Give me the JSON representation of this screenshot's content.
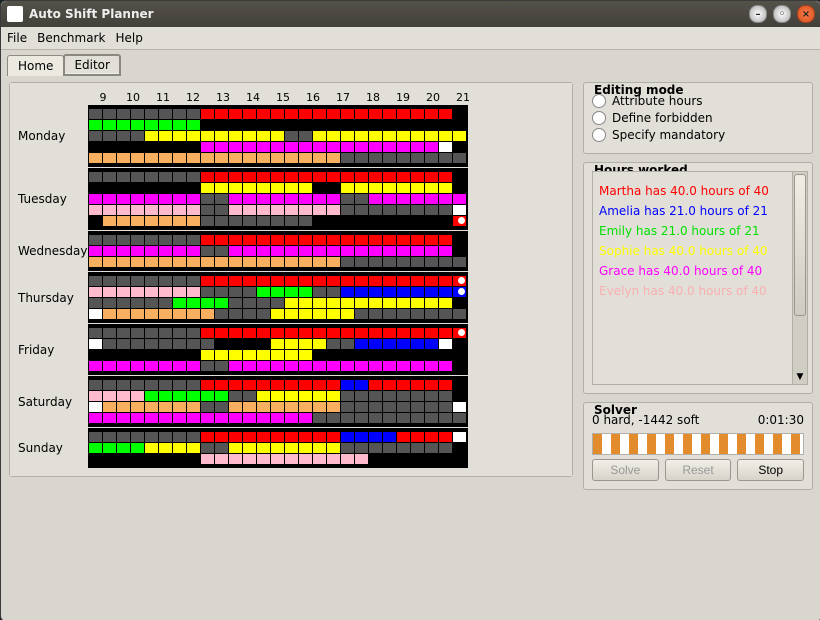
{
  "window_title": "Auto Shift Planner",
  "menu": [
    "File",
    "Benchmark",
    "Help"
  ],
  "tabs": [
    {
      "label": "Home",
      "active": false
    },
    {
      "label": "Editor",
      "active": true
    }
  ],
  "editor_title": "Editor",
  "hours": [
    "9",
    "10",
    "11",
    "12",
    "13",
    "14",
    "15",
    "16",
    "17",
    "18",
    "19",
    "20",
    "21"
  ],
  "cols": 27,
  "days": [
    "Monday",
    "Tuesday",
    "Wednesday",
    "Thursday",
    "Friday",
    "Saturday",
    "Sunday"
  ],
  "schedule": {
    "Monday": [
      [
        [
          "#555",
          8
        ],
        [
          "#f00",
          18
        ],
        [
          "#000",
          1
        ]
      ],
      [
        [
          "#0f0",
          8
        ],
        [
          "#000",
          19
        ]
      ],
      [
        [
          "#555",
          4
        ],
        [
          "#ff0",
          10
        ],
        [
          "#555",
          2
        ],
        [
          "#ff0",
          11
        ]
      ],
      [
        [
          "#000",
          8
        ],
        [
          "#f0f",
          17
        ],
        [
          "#fff",
          1,
          true
        ],
        [
          "#000",
          1
        ]
      ],
      [
        [
          "#f8b060",
          18
        ],
        [
          "#555",
          9
        ]
      ]
    ],
    "Tuesday": [
      [
        [
          "#555",
          8
        ],
        [
          "#f00",
          18
        ],
        [
          "#000",
          1
        ]
      ],
      [
        [
          "#000",
          8
        ],
        [
          "#ff0",
          8
        ],
        [
          "#000",
          2
        ],
        [
          "#ff0",
          8
        ],
        [
          "#000",
          1
        ]
      ],
      [
        [
          "#f0f",
          8
        ],
        [
          "#555",
          2
        ],
        [
          "#f0f",
          8
        ],
        [
          "#555",
          2
        ],
        [
          "#f0f",
          7
        ]
      ],
      [
        [
          "#fbc",
          8
        ],
        [
          "#555",
          2
        ],
        [
          "#fbc",
          8
        ],
        [
          "#555",
          8
        ],
        [
          "#fff",
          1,
          true
        ]
      ],
      [
        [
          "#000",
          1
        ],
        [
          "#f8b060",
          7
        ],
        [
          "#555",
          8
        ],
        [
          "#000",
          10
        ],
        [
          "#f00",
          1,
          true
        ]
      ]
    ],
    "Wednesday": [
      [
        [
          "#555",
          8
        ],
        [
          "#f00",
          18
        ],
        [
          "#000",
          1
        ]
      ],
      [
        [
          "#f0f",
          8
        ],
        [
          "#555",
          2
        ],
        [
          "#f0f",
          16
        ],
        [
          "#000",
          1
        ]
      ],
      [
        [
          "#f8b060",
          18
        ],
        [
          "#555",
          9
        ]
      ]
    ],
    "Thursday": [
      [
        [
          "#555",
          8
        ],
        [
          "#f00",
          18
        ],
        [
          "#f00",
          1,
          true
        ]
      ],
      [
        [
          "#fbc",
          8
        ],
        [
          "#555",
          4
        ],
        [
          "#0f0",
          4
        ],
        [
          "#555",
          2
        ],
        [
          "#00f",
          8
        ],
        [
          "#00f",
          1,
          true
        ]
      ],
      [
        [
          "#555",
          6
        ],
        [
          "#0f0",
          4
        ],
        [
          "#555",
          4
        ],
        [
          "#ff0",
          12
        ],
        [
          "#000",
          1
        ]
      ],
      [
        [
          "#fff",
          1,
          true
        ],
        [
          "#f8b060",
          8
        ],
        [
          "#555",
          4
        ],
        [
          "#ff0",
          6
        ],
        [
          "#555",
          8
        ]
      ]
    ],
    "Friday": [
      [
        [
          "#555",
          8
        ],
        [
          "#f00",
          18
        ],
        [
          "#f00",
          1,
          true
        ]
      ],
      [
        [
          "#fff",
          1,
          true
        ],
        [
          "#555",
          8
        ],
        [
          "#000",
          4
        ],
        [
          "#ff0",
          4
        ],
        [
          "#555",
          2
        ],
        [
          "#00f",
          6
        ],
        [
          "#fff",
          1,
          true
        ],
        [
          "#000",
          1
        ]
      ],
      [
        [
          "#000",
          8
        ],
        [
          "#ff0",
          8
        ],
        [
          "#000",
          11
        ]
      ],
      [
        [
          "#f0f",
          8
        ],
        [
          "#555",
          2
        ],
        [
          "#f0f",
          16
        ],
        [
          "#000",
          1
        ]
      ]
    ],
    "Saturday": [
      [
        [
          "#555",
          8
        ],
        [
          "#f00",
          10
        ],
        [
          "#00f",
          2
        ],
        [
          "#f00",
          6
        ],
        [
          "#000",
          1
        ]
      ],
      [
        [
          "#fbc",
          4
        ],
        [
          "#0f0",
          6
        ],
        [
          "#555",
          2
        ],
        [
          "#ff0",
          6
        ],
        [
          "#555",
          8
        ],
        [
          "#000",
          1
        ]
      ],
      [
        [
          "#fff",
          1,
          true
        ],
        [
          "#f8b060",
          7
        ],
        [
          "#555",
          2
        ],
        [
          "#f8b060",
          8
        ],
        [
          "#555",
          8
        ],
        [
          "#fff",
          1,
          true
        ]
      ],
      [
        [
          "#f0f",
          16
        ],
        [
          "#555",
          11
        ]
      ]
    ],
    "Sunday": [
      [
        [
          "#555",
          8
        ],
        [
          "#f00",
          10
        ],
        [
          "#00f",
          4
        ],
        [
          "#f00",
          4
        ],
        [
          "#fff",
          1,
          true
        ]
      ],
      [
        [
          "#0f0",
          4
        ],
        [
          "#ff0",
          4
        ],
        [
          "#555",
          2
        ],
        [
          "#ff0",
          8
        ],
        [
          "#555",
          8
        ],
        [
          "#000",
          1
        ]
      ],
      [
        [
          "#000",
          8
        ],
        [
          "#fbc",
          12
        ],
        [
          "#000",
          7
        ]
      ]
    ]
  },
  "editing_mode_title": "Editing mode",
  "editing_modes": [
    "Attribute hours",
    "Define forbidden",
    "Specify mandatory"
  ],
  "hours_worked_title": "Hours worked",
  "hours_worked": [
    {
      "text": "Martha has 40.0 hours of 40",
      "color": "#ff0000"
    },
    {
      "text": "Amelia has 21.0 hours of 21",
      "color": "#0000ff"
    },
    {
      "text": "Emily has 21.0 hours of 21",
      "color": "#00e000"
    },
    {
      "text": "Sophie has 40.0 hours of 40",
      "color": "#ffff00"
    },
    {
      "text": "Grace has 40.0 hours of 40",
      "color": "#ff00ff"
    },
    {
      "text": "Evelyn has 40.0 hours of 40",
      "color": "#f8b0b0"
    }
  ],
  "solver_title": "Solver",
  "solver_status": "0 hard, -1442 soft",
  "solver_time": "0:01:30",
  "buttons": {
    "solve": "Solve",
    "reset": "Reset",
    "stop": "Stop"
  }
}
